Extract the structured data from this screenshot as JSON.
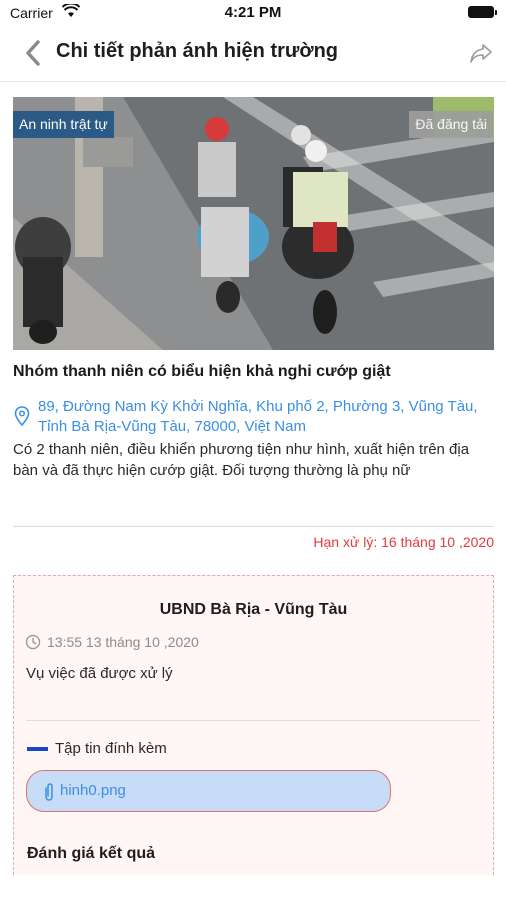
{
  "status_bar": {
    "carrier": "Carrier",
    "time": "4:21 PM"
  },
  "nav": {
    "title": "Chi tiết phản ánh hiện trường",
    "back_icon": "chevron-left-icon",
    "share_icon": "share-icon"
  },
  "report": {
    "category_badge": "An ninh trật tự",
    "status_badge": "Đã đăng tải",
    "title": "Nhóm thanh niên có biểu hiện khả nghi cướp giật",
    "address": "89, Đường Nam Kỳ Khởi Nghĩa, Khu phố 2, Phường 3, Vũng Tàu, Tỉnh Bà Rịa-Vũng Tàu, 78000, Việt Nam",
    "description": "Có 2 thanh niên, điều khiển phương tiện như hình, xuất hiện trên địa bàn và đã thực hiện cướp giật. Đối tượng thường là phụ nữ",
    "deadline": "Hạn xử lý: 16 tháng 10 ,2020"
  },
  "response": {
    "responder": "UBND Bà Rịa - Vũng Tàu",
    "time": "13:55 13 tháng 10 ,2020",
    "text": "Vụ việc đã được xử lý",
    "attachments_label": "Tập tin đính kèm",
    "file_name": "hinh0.png",
    "rating_label": "Đánh giá kết quả"
  },
  "colors": {
    "accent_blue": "#3b8ee6",
    "deadline_red": "#e53b3b",
    "category_badge_bg": "#2c5a86",
    "card_border": "#f0a3a3",
    "file_pill_bg": "#c7dcf6"
  }
}
